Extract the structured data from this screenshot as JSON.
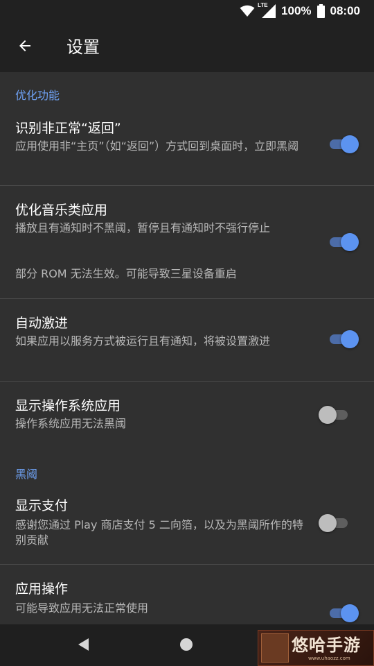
{
  "status_bar": {
    "battery_percent": "100%",
    "time": "08:00",
    "network_label": "LTE",
    "icons": [
      "wifi-icon",
      "lte-signal-icon",
      "battery-full-icon"
    ]
  },
  "app_bar": {
    "title": "设置",
    "back_icon": "arrow-back-icon"
  },
  "sections": [
    {
      "header": "优化功能",
      "items": [
        {
          "title": "识别非正常“返回”",
          "summary": "应用使用非“主页”（如“返回”）方式回到桌面时，立即黑阈",
          "enabled": true
        },
        {
          "title": "优化音乐类应用",
          "summary": "播放且有通知时不黑阈，暂停且有通知时不强行停止",
          "note": "部分 ROM 无法生效。可能导致三星设备重启",
          "enabled": true
        },
        {
          "title": "自动激进",
          "summary": "如果应用以服务方式被运行且有通知，将被设置激进",
          "enabled": true
        },
        {
          "title": "显示操作系统应用",
          "summary": "操作系统应用无法黑阈",
          "enabled": false
        }
      ]
    },
    {
      "header": "黑阈",
      "items": [
        {
          "title": "显示支付",
          "summary": "感谢您通过 Play 商店支付 5 二向箔，以及为黑阈所作的特别贡献",
          "enabled": false
        },
        {
          "title": "应用操作",
          "summary": "可能导致应用无法正常使用",
          "enabled": true
        }
      ]
    }
  ],
  "nav_bar": {
    "icons": [
      "nav-back-icon",
      "nav-home-icon"
    ]
  },
  "watermark": {
    "text": "悠哈手游",
    "url": "www.uhaozz.com"
  },
  "colors": {
    "background": "#303030",
    "app_bar": "#212121",
    "accent": "#6ea0f2",
    "switch_on_thumb": "#5c93f0",
    "switch_on_track": "#4c6ca8",
    "switch_off_thumb": "#bdbdbd",
    "switch_off_track": "#5e5e5e"
  }
}
